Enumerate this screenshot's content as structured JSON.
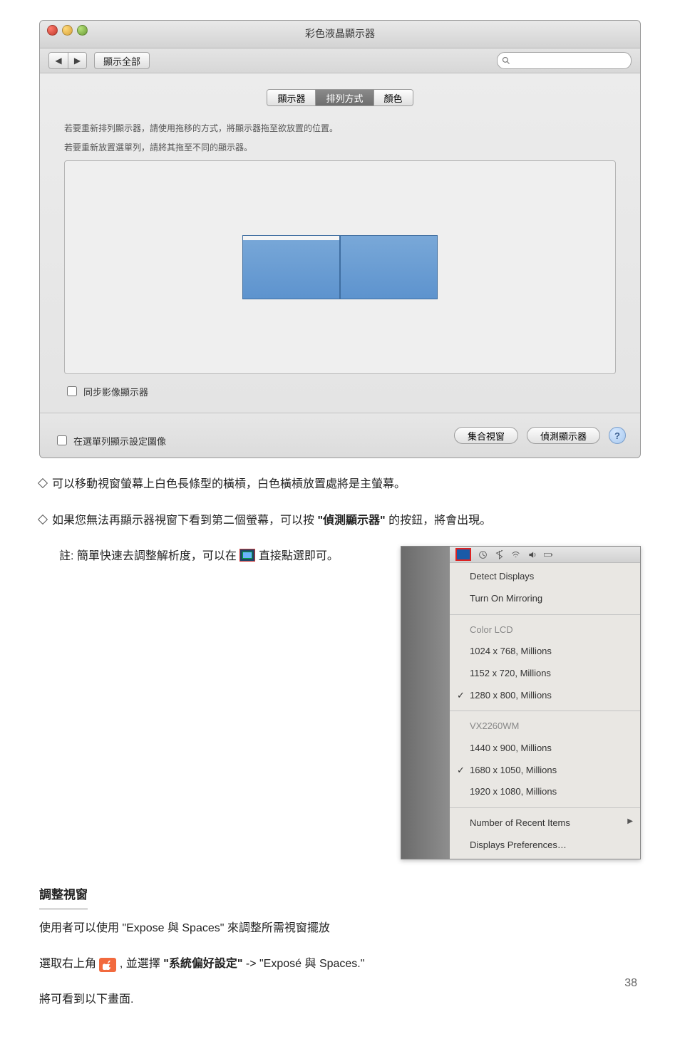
{
  "page_number": "38",
  "mac_window": {
    "title": "彩色液晶顯示器",
    "show_all": "顯示全部",
    "search_placeholder": "",
    "tabs": {
      "display": "顯示器",
      "arrangement": "排列方式",
      "color": "顏色"
    },
    "instructions_line1": "若要重新排列顯示器，請使用拖移的方式，將顯示器拖至欲放置的位置。",
    "instructions_line2": "若要重新放置選單列，請將其拖至不同的顯示器。",
    "mirror_checkbox": "同步影像顯示器",
    "show_in_menubar": "在選單列顯示設定圖像",
    "gather_windows": "集合視窗",
    "detect_displays": "偵測顯示器"
  },
  "bullets": {
    "b1": "可以移動視窗螢幕上白色長條型的橫槓，白色橫槓放置處將是主螢幕。",
    "b2_a": "如果您無法再顯示器視窗下看到第二個螢幕，可以按 ",
    "b2_bold": "\"偵測顯示器\"",
    "b2_b": " 的按鈕，將會出現。"
  },
  "note": {
    "prefix": "註: 簡單快速去調整解析度，可以在",
    "suffix": " 直接點選即可。"
  },
  "menu": {
    "detect": "Detect Displays",
    "mirror": "Turn On Mirroring",
    "g1_head": "Color LCD",
    "g1_r1": "1024 x 768, Millions",
    "g1_r2": "1152 x 720, Millions",
    "g1_r3": "1280 x 800, Millions",
    "g2_head": "VX2260WM",
    "g2_r1": "1440 x 900, Millions",
    "g2_r2": "1680 x 1050, Millions",
    "g2_r3": "1920 x 1080, Millions",
    "recent": "Number of Recent Items",
    "prefs": "Displays Preferences…"
  },
  "sections": {
    "adjust_window": "調整視窗",
    "expose_line": "使用者可以使用 \"Expose 與 Spaces\" 來調整所需視窗擺放",
    "path_a": "選取右上角 ",
    "path_b": ", 並選擇 ",
    "path_bold": "\"系統偏好設定\"",
    "path_c": " -> \"Exposé 與 Spaces.\"",
    "path_after": "將可看到以下畫面."
  }
}
